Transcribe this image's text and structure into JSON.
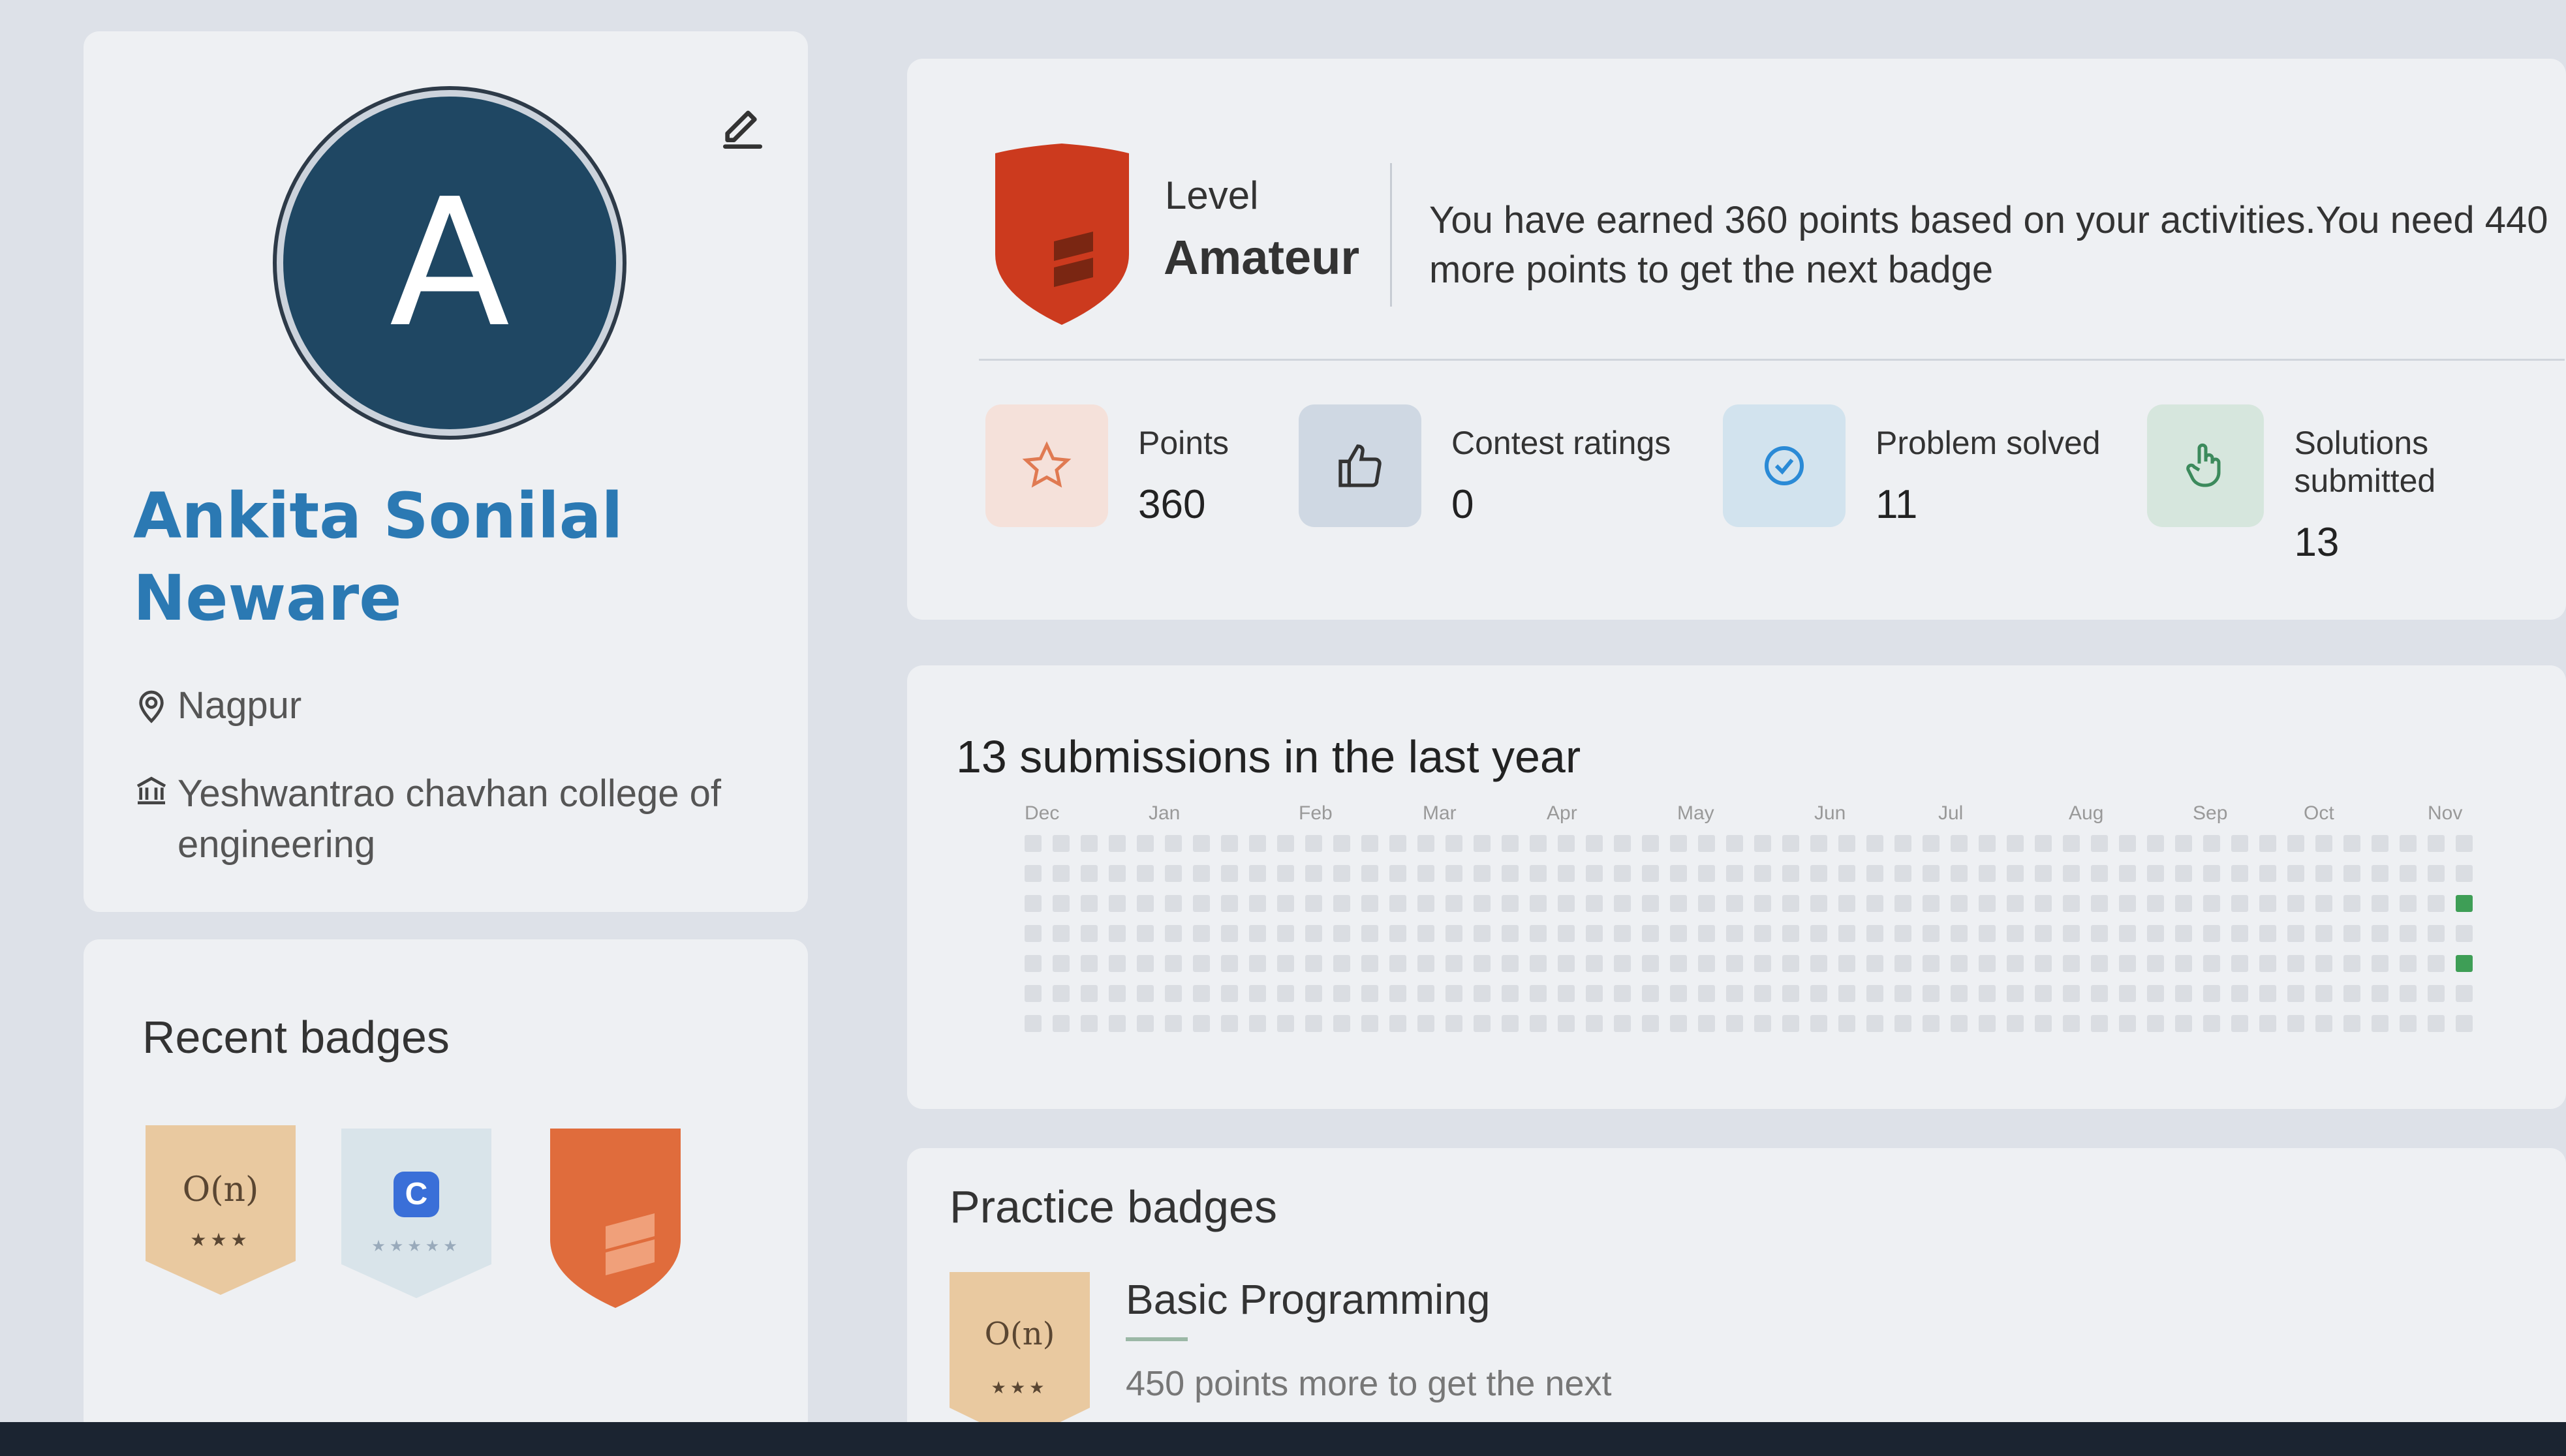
{
  "profile": {
    "avatar_letter": "A",
    "name": "Ankita Sonilal Neware",
    "location": "Nagpur",
    "college": "Yeshwantrao chavhan college of engineering"
  },
  "recent_badges": {
    "title": "Recent badges",
    "items": [
      {
        "kind": "complexity",
        "text": "O(n)",
        "stars": "★★★"
      },
      {
        "kind": "language",
        "text": "C",
        "stars": "★★★★★"
      },
      {
        "kind": "level-shield"
      }
    ]
  },
  "level": {
    "label": "Level",
    "value": "Amateur",
    "message": "You have earned 360 points based on your activities.You need 440 more points to get the next badge"
  },
  "stats": [
    {
      "label": "Points",
      "value": "360",
      "icon": "star-icon",
      "color": "#f5e1da"
    },
    {
      "label": "Contest ratings",
      "value": "0",
      "icon": "thumbs-up-icon",
      "color": "#cfd8e3"
    },
    {
      "label": "Problem solved",
      "value": "11",
      "icon": "check-circle-icon",
      "color": "#d2e3ee"
    },
    {
      "label": "Solutions submitted",
      "value": "13",
      "icon": "hand-pointer-icon",
      "color": "#d6e6dd"
    }
  ],
  "submissions": {
    "title": "13 submissions in the last year",
    "months": [
      "Dec",
      "Jan",
      "Feb",
      "Mar",
      "Apr",
      "May",
      "Jun",
      "Jul",
      "Aug",
      "Sep",
      "Oct",
      "Nov"
    ]
  },
  "practice": {
    "title": "Practice badges",
    "badge": {
      "text": "O(n)",
      "stars": "★★★"
    },
    "name": "Basic Programming",
    "remaining": "450 points more to get the next"
  }
}
